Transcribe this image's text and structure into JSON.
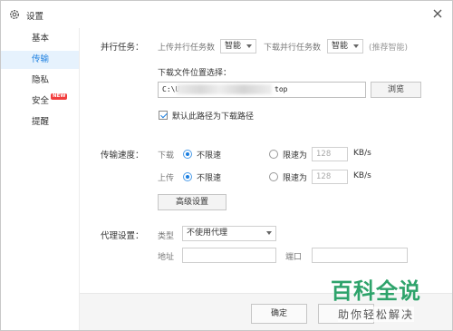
{
  "window": {
    "title": "设置"
  },
  "sidebar": {
    "items": [
      {
        "label": "基本"
      },
      {
        "label": "传输"
      },
      {
        "label": "隐私"
      },
      {
        "label": "安全",
        "badge": "NEW"
      },
      {
        "label": "提醒"
      }
    ],
    "active_index": 1
  },
  "parallel": {
    "title": "并行任务：",
    "upload_label": "上传并行任务数",
    "upload_value": "智能",
    "download_label": "下载并行任务数",
    "download_value": "智能",
    "hint": "(推荐智能)"
  },
  "download_location": {
    "label": "下载文件位置选择：",
    "path_start": "C:\\U",
    "path_end": "top",
    "browse_label": "浏览",
    "default_checkbox_label": "默认此路径为下载路径",
    "default_checked": true
  },
  "speed": {
    "title": "传输速度：",
    "download": {
      "label": "下载",
      "unlimited_label": "不限速",
      "limit_label": "限速为",
      "limit_value": "128",
      "unit": "KB/s",
      "mode": "unlimited"
    },
    "upload": {
      "label": "上传",
      "unlimited_label": "不限速",
      "limit_label": "限速为",
      "limit_value": "128",
      "unit": "KB/s",
      "mode": "unlimited"
    },
    "advanced_label": "高级设置"
  },
  "proxy": {
    "title": "代理设置：",
    "type_label": "类型",
    "type_value": "不使用代理",
    "address_label": "地址",
    "address_value": "",
    "port_label": "端口",
    "port_value": ""
  },
  "footer": {
    "confirm_label": "确定"
  },
  "watermark": {
    "title": "百科全说",
    "subtitle": "助你轻松解决"
  },
  "colors": {
    "accent": "#1a7ee0",
    "active_bg": "#e6f2fd",
    "badge": "#f23d3d",
    "watermark": "#2ea36b"
  }
}
